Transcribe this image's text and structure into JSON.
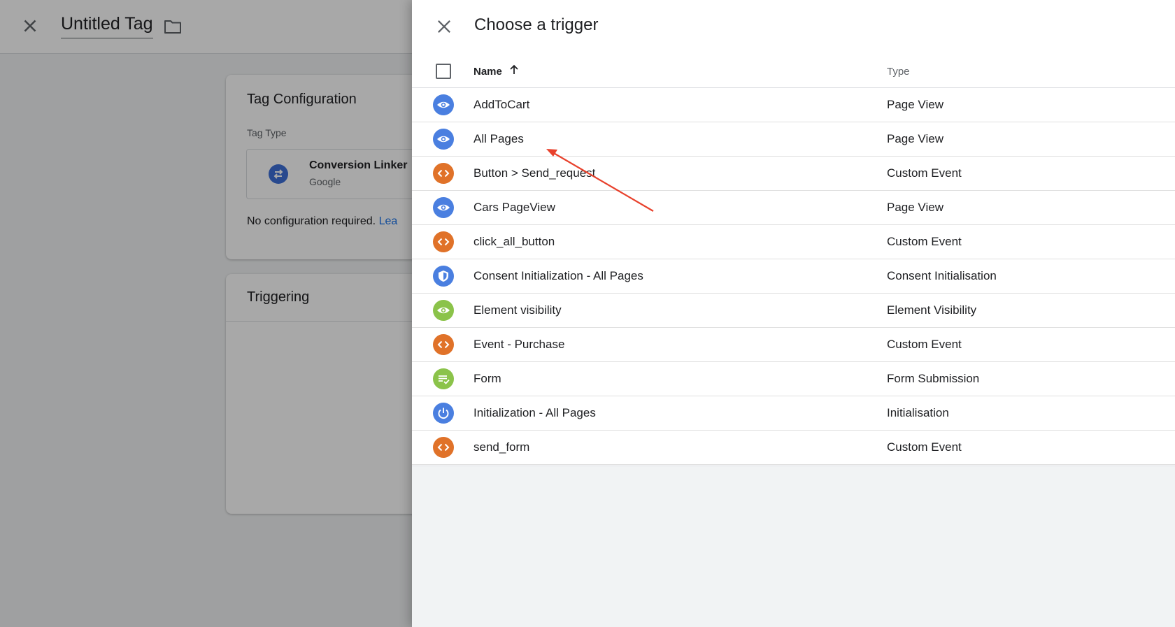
{
  "editor": {
    "title": "Untitled Tag",
    "tag_configuration": {
      "heading": "Tag Configuration",
      "tag_type_label": "Tag Type",
      "tag_name": "Conversion Linker",
      "tag_vendor": "Google",
      "note": "No configuration required.",
      "link_text": "Lea"
    },
    "triggering": {
      "heading": "Triggering"
    }
  },
  "panel": {
    "title": "Choose a trigger",
    "columns": {
      "name": "Name",
      "type": "Type"
    },
    "sort": "ascending",
    "rows": [
      {
        "name": "AddToCart",
        "type": "Page View",
        "icon": "eye-icon",
        "color": "#4a7fe0"
      },
      {
        "name": "All Pages",
        "type": "Page View",
        "icon": "eye-icon",
        "color": "#4a7fe0"
      },
      {
        "name": "Button > Send_request",
        "type": "Custom Event",
        "icon": "code-icon",
        "color": "#e07229"
      },
      {
        "name": "Cars PageView",
        "type": "Page View",
        "icon": "eye-icon",
        "color": "#4a7fe0"
      },
      {
        "name": "click_all_button",
        "type": "Custom Event",
        "icon": "code-icon",
        "color": "#e07229"
      },
      {
        "name": "Consent Initialization - All Pages",
        "type": "Consent Initialisation",
        "icon": "shield-icon",
        "color": "#4a7fe0"
      },
      {
        "name": "Element visibility",
        "type": "Element Visibility",
        "icon": "eye-icon",
        "color": "#8bc34a"
      },
      {
        "name": "Event - Purchase",
        "type": "Custom Event",
        "icon": "code-icon",
        "color": "#e07229"
      },
      {
        "name": "Form",
        "type": "Form Submission",
        "icon": "form-icon",
        "color": "#8bc34a"
      },
      {
        "name": "Initialization - All Pages",
        "type": "Initialisation",
        "icon": "power-icon",
        "color": "#4a7fe0"
      },
      {
        "name": "send_form",
        "type": "Custom Event",
        "icon": "code-icon",
        "color": "#e07229"
      }
    ]
  },
  "annotation": {
    "arrow_color": "#e8412c",
    "points_to": "All Pages"
  }
}
